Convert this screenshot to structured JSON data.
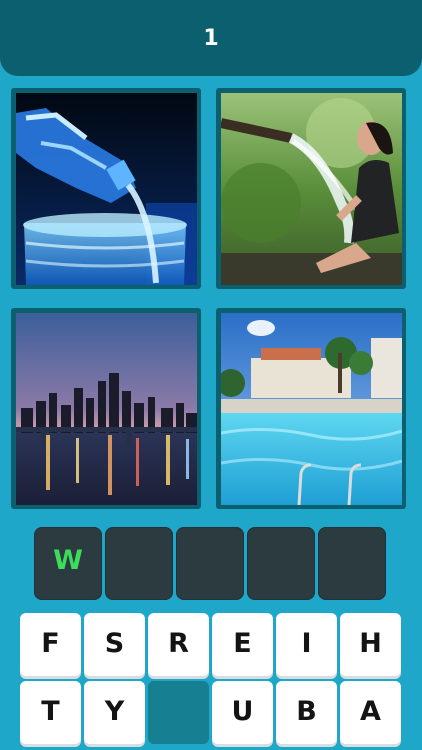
{
  "header": {
    "level": "1"
  },
  "puzzle": {
    "images": [
      {
        "name": "water-bottle-pouring-image"
      },
      {
        "name": "woman-under-water-hose-image"
      },
      {
        "name": "city-river-night-image"
      },
      {
        "name": "swimming-pool-image"
      }
    ]
  },
  "answer": {
    "slots": [
      "W",
      "",
      "",
      "",
      ""
    ],
    "letter_color": "#3ddc5a"
  },
  "keyboard": {
    "row1": [
      "F",
      "S",
      "R",
      "E",
      "I",
      "H"
    ],
    "row2": [
      "T",
      "Y",
      "",
      "U",
      "B",
      "A"
    ]
  },
  "colors": {
    "background": "#1ea7c8",
    "header": "#0c5f6f",
    "slot": "#2b3b40"
  }
}
